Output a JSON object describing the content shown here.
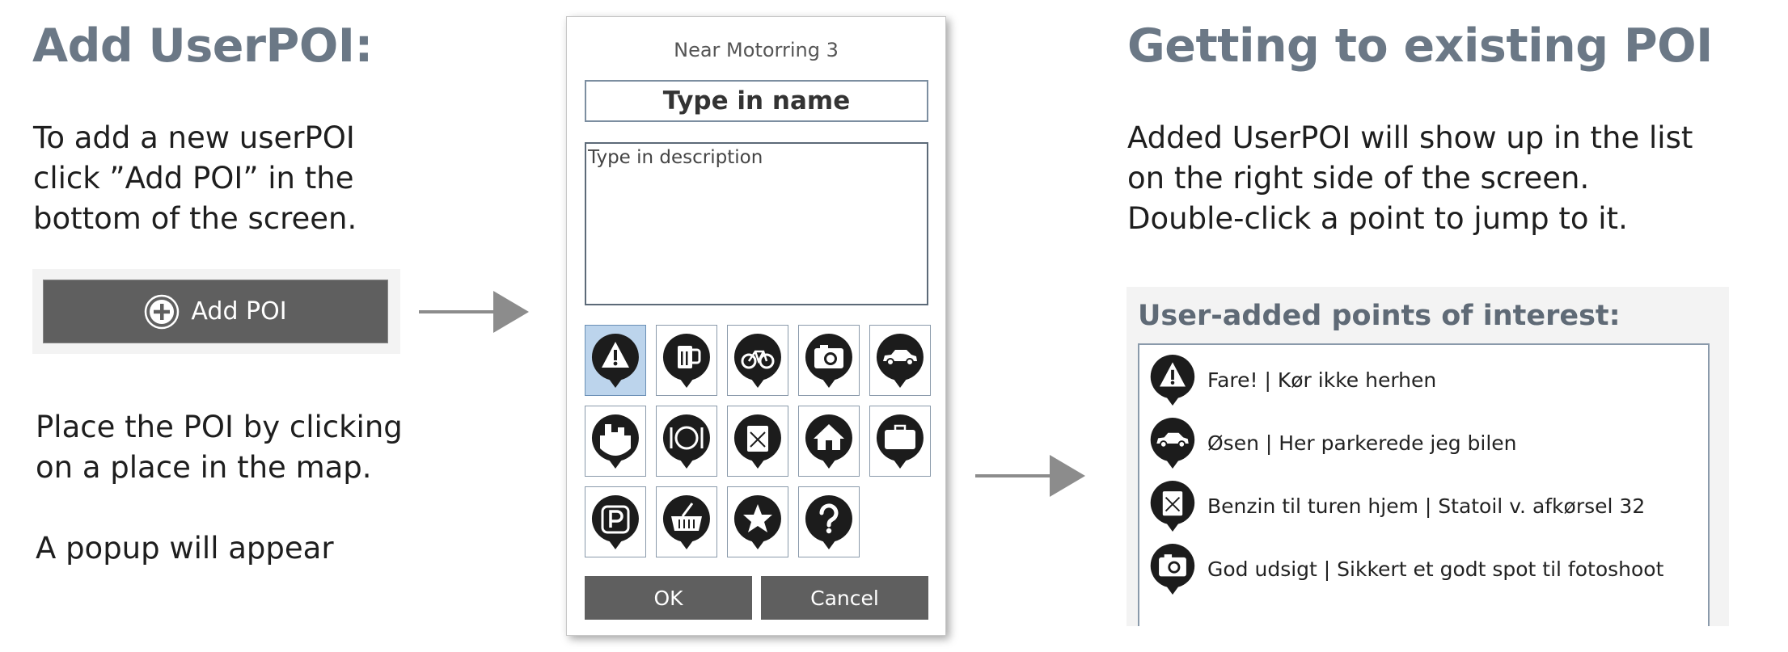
{
  "left": {
    "heading": "Add UserPOI:",
    "intro_lines": [
      "To add a new userPOI",
      "click ”Add POI” in the",
      "bottom of the screen."
    ],
    "add_poi_label": "Add POI",
    "place_lines": [
      "Place the POI by clicking",
      "on a place in the map."
    ],
    "popup_text": "A popup will appear"
  },
  "dialog": {
    "title": "Near Motorring 3",
    "name_placeholder": "Type in name",
    "description_placeholder": "Type in description",
    "icons": [
      "warning-icon",
      "beer-icon",
      "bicycle-icon",
      "camera-icon",
      "car-icon",
      "city-icon",
      "restaurant-icon",
      "fuel-icon",
      "home-icon",
      "briefcase-icon",
      "parking-icon",
      "shopping-basket-icon",
      "star-icon",
      "question-icon"
    ],
    "selected_icon": "warning-icon",
    "ok_label": "OK",
    "cancel_label": "Cancel"
  },
  "right": {
    "heading": "Getting to existing POI",
    "lines": [
      "Added UserPOI will show up in the list",
      "on the right side of the screen.",
      "Double-click a point to jump to it."
    ],
    "list_title": "User-added points of interest:",
    "items": [
      {
        "icon": "warning-icon",
        "text": "Fare! | Kør ikke herhen"
      },
      {
        "icon": "car-icon",
        "text": "Øsen | Her parkerede jeg bilen"
      },
      {
        "icon": "fuel-icon",
        "text": "Benzin til turen hjem | Statoil v. afkørsel 32"
      },
      {
        "icon": "camera-icon",
        "text": "God udsigt | Sikkert et godt spot til fotoshoot"
      }
    ]
  },
  "colors": {
    "heading": "#6b7886",
    "button": "#5f5f5f",
    "selected": "#bcd4ec",
    "arrow": "#8c8c8c"
  }
}
